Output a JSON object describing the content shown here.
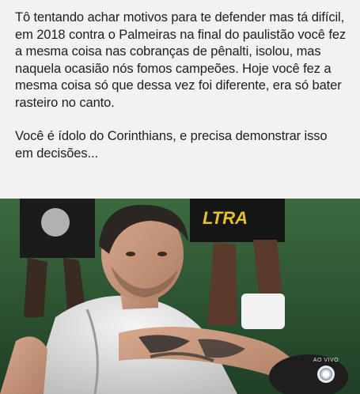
{
  "post": {
    "paragraphs": [
      "Tô tentando achar motivos para te defender mas tá difícil, em 2018 contra o Palmeiras na final do paulistão você fez a mesma coisa nas cobranças de pênalti, isolou, mas naquela ocasião nós fomos campeões. Hoje você fez a mesma coisa só que dessa vez foi diferente, era só bater rasteiro no canto.",
      "Você é ídolo do Corinthians, e precisa demonstrar isso em decisões..."
    ]
  },
  "media": {
    "background_color": "#2f5a37",
    "sponsor_text": "LTRA",
    "broadcaster_badge": "AO VIVO",
    "broadcaster_icon": "globo-logo-icon"
  }
}
